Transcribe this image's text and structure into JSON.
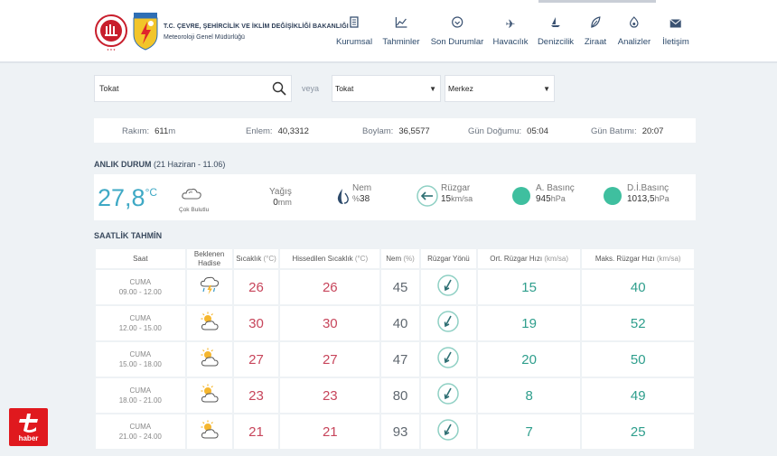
{
  "header": {
    "org_line1": "T.C. ÇEVRE, ŞEHİRCİLİK VE İKLİM DEĞİŞİKLİĞİ BAKANLIĞI",
    "org_line2": "Meteoroloji Genel Müdürlüğü",
    "logo_text": "METEOROLOJİ",
    "nav": [
      {
        "label": "Kurumsal",
        "icon": "document-icon"
      },
      {
        "label": "Tahminler",
        "icon": "chart-icon"
      },
      {
        "label": "Son Durumlar",
        "icon": "clock-icon"
      },
      {
        "label": "Havacılık",
        "icon": "plane-icon"
      },
      {
        "label": "Denizcilik",
        "icon": "ship-icon"
      },
      {
        "label": "Ziraat",
        "icon": "leaf-icon"
      },
      {
        "label": "Analizler",
        "icon": "analysis-icon"
      },
      {
        "label": "İletişim",
        "icon": "mail-icon"
      }
    ]
  },
  "search": {
    "value": "Tokat",
    "or_label": "veya",
    "province_select": "Tokat",
    "district_select": "Merkez"
  },
  "info": {
    "rakim_label": "Rakım:",
    "rakim_value": "611",
    "rakim_unit": "m",
    "enlem_label": "Enlem:",
    "enlem_value": "40,3312",
    "boylam_label": "Boylam:",
    "boylam_value": "36,5577",
    "gundogumu_label": "Gün Doğumu:",
    "gundogumu_value": "05:04",
    "gunbatimi_label": "Gün Batımı:",
    "gunbatimi_value": "20:07"
  },
  "current": {
    "section_title": "ANLIK DURUM",
    "section_sub": "(21 Haziran - 11.06)",
    "temperature": "27,8",
    "temperature_unit": "°C",
    "condition": "Çok Bulutlu",
    "yagis_label": "Yağış",
    "yagis_value": "0",
    "yagis_unit": "mm",
    "nem_label": "Nem",
    "nem_unit": "%",
    "nem_value": "38",
    "ruzgar_label": "Rüzgar",
    "ruzgar_value": "15",
    "ruzgar_unit": "km/sa",
    "abasinc_label": "A. Basınç",
    "abasinc_value": "945",
    "abasinc_unit": "hPa",
    "dibasinc_label": "D.İ.Basınç",
    "dibasinc_value": "1013,5",
    "dibasinc_unit": "hPa",
    "colors": {
      "temp": "#3fa9c5",
      "pressure": "#3fbf9f"
    }
  },
  "hourly": {
    "section_title": "SAATLİK TAHMİN",
    "headers": {
      "saat": "Saat",
      "hadise_1": "Beklenen",
      "hadise_2": "Hadise",
      "sicaklik": "Sıcaklık",
      "sicaklik_unit": "(°C)",
      "hissedilen": "Hissedilen Sıcaklık",
      "hissedilen_unit": "(°C)",
      "nem": "Nem",
      "nem_unit": "(%)",
      "ruzgar_yonu": "Rüzgar Yönü",
      "ort_ruzgar": "Ort. Rüzgar Hızı",
      "ort_ruzgar_unit": "(km/sa)",
      "maks_ruzgar": "Maks. Rüzgar Hızı",
      "maks_ruzgar_unit": "(km/sa)"
    },
    "rows": [
      {
        "day": "CUMA",
        "time": "09.00 - 12.00",
        "icon": "thunder-rain-icon",
        "temp": "26",
        "feels": "26",
        "humidity": "45",
        "wind_avg": "15",
        "wind_max": "40"
      },
      {
        "day": "CUMA",
        "time": "12.00 - 15.00",
        "icon": "partly-cloudy-icon",
        "temp": "30",
        "feels": "30",
        "humidity": "40",
        "wind_avg": "19",
        "wind_max": "52"
      },
      {
        "day": "CUMA",
        "time": "15.00 - 18.00",
        "icon": "partly-cloudy-icon",
        "temp": "27",
        "feels": "27",
        "humidity": "47",
        "wind_avg": "20",
        "wind_max": "50"
      },
      {
        "day": "CUMA",
        "time": "18.00 - 21.00",
        "icon": "partly-cloudy-icon",
        "temp": "23",
        "feels": "23",
        "humidity": "80",
        "wind_avg": "8",
        "wind_max": "49"
      },
      {
        "day": "CUMA",
        "time": "21.00 - 24.00",
        "icon": "partly-cloudy-icon",
        "temp": "21",
        "feels": "21",
        "humidity": "93",
        "wind_avg": "7",
        "wind_max": "25"
      }
    ]
  },
  "watermark": {
    "text": "haber"
  }
}
